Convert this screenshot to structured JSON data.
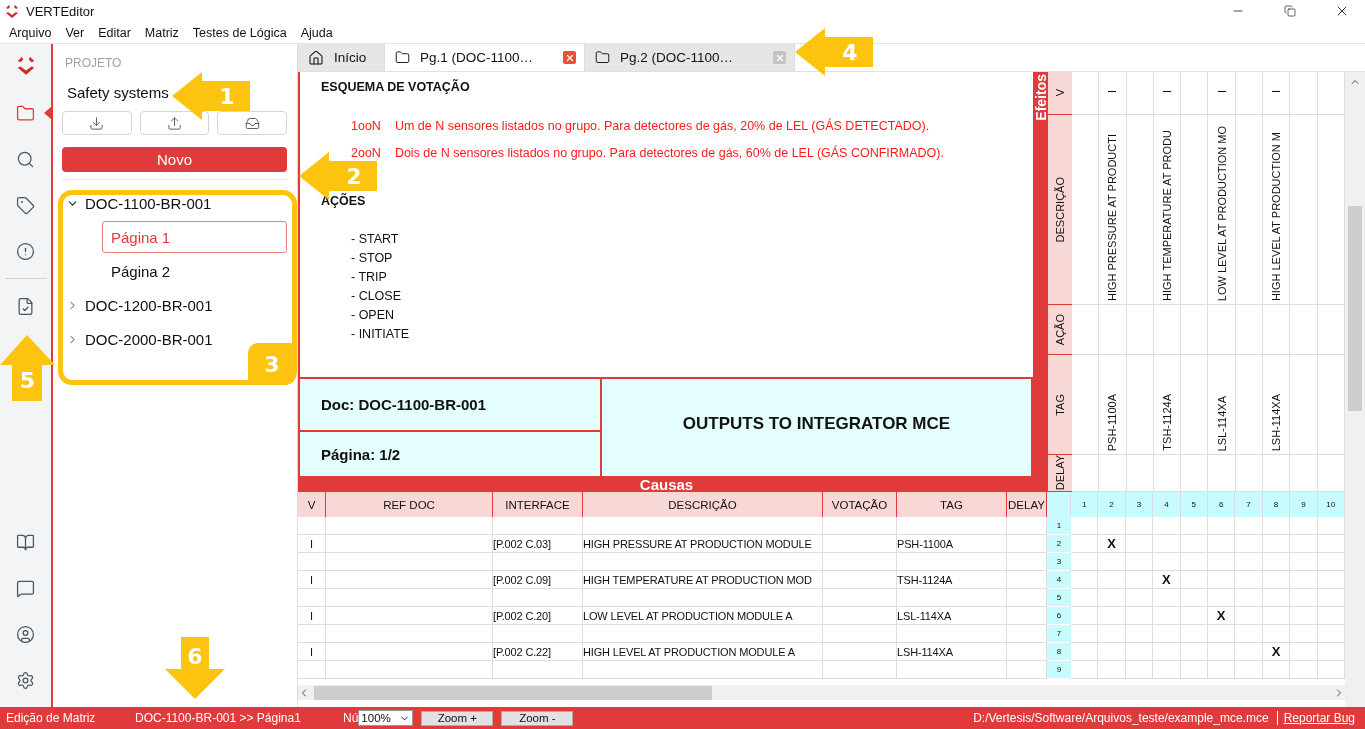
{
  "window": {
    "title": "VERTEditor"
  },
  "menu": [
    "Arquivo",
    "Ver",
    "Editar",
    "Matriz",
    "Testes de Lógica",
    "Ajuda"
  ],
  "rail": [
    {
      "selected": true
    },
    {
      "selected": false
    },
    {
      "selected": false
    },
    {
      "selected": false
    },
    {
      "selected": false
    },
    {
      "selected": false
    },
    {
      "selected": false
    },
    {
      "selected": false
    },
    {
      "selected": false
    }
  ],
  "project": {
    "label": "PROJETO",
    "name": "Safety systems",
    "new_button": "Novo",
    "tree": [
      {
        "label": "DOC-1100-BR-001",
        "expanded": true,
        "children": [
          {
            "label": "Página 1",
            "selected": true
          },
          {
            "label": "Página 2",
            "selected": false
          }
        ]
      },
      {
        "label": "DOC-1200-BR-001",
        "expanded": false
      },
      {
        "label": "DOC-2000-BR-001",
        "expanded": false
      }
    ]
  },
  "tabs": [
    {
      "kind": "home",
      "label": "Início",
      "selected": false
    },
    {
      "kind": "page",
      "label": "Pg.1 (DOC-1100…",
      "selected": true
    },
    {
      "kind": "page",
      "label": "Pg.2 (DOC-1100…",
      "selected": false
    }
  ],
  "document": {
    "voting_title": "ESQUEMA DE VOTAÇÃO",
    "voting": [
      {
        "code": "1ooN",
        "text": "Um de N sensores listados no grupo. Para detectores de gás, 20% de LEL (GÁS DETECTADO)."
      },
      {
        "code": "2ooN",
        "text": "Dois de N sensores listados no grupo. Para detectores de gás, 60% de LEL (GÁS CONFIRMADO)."
      }
    ],
    "actions_title": "AÇÕES",
    "actions": [
      "- START",
      "- STOP",
      "- TRIP",
      "- CLOSE",
      "- OPEN",
      "- INITIATE"
    ],
    "doc": "Doc: DOC-1100-BR-001",
    "page": "Página: 1/2",
    "title": "OUTPUTS TO INTEGRATOR MCE"
  },
  "causes": {
    "title": "Causas",
    "columns": [
      "V",
      "REF DOC",
      "INTERFACE",
      "DESCRIÇÃO",
      "VOTAÇÃO",
      "TAG",
      "DELAY"
    ],
    "matrix_columns": [
      "1",
      "2",
      "3",
      "4",
      "5",
      "6",
      "7",
      "8",
      "9",
      "10"
    ],
    "rows": [
      {
        "number": "1"
      },
      {
        "number": "2",
        "v": "I",
        "interface": "[P.002 C.03]",
        "description": "HIGH PRESSURE AT PRODUCTION MODULE",
        "tag": "PSH-1100A",
        "mark": "X",
        "marks": [
          {
            "checked": false
          },
          {
            "checked": true
          },
          {
            "checked": false
          },
          {
            "checked": false
          },
          {
            "checked": false
          },
          {
            "checked": false
          },
          {
            "checked": false
          },
          {
            "checked": false
          },
          {
            "checked": false
          },
          {
            "checked": false
          }
        ]
      },
      {
        "number": "3"
      },
      {
        "number": "4",
        "v": "I",
        "interface": "[P.002 C.09]",
        "description": "HIGH TEMPERATURE AT PRODUCTION MOD",
        "tag": "TSH-1124A",
        "mark": "X",
        "marks": [
          {
            "checked": false
          },
          {
            "checked": false
          },
          {
            "checked": false
          },
          {
            "checked": true
          },
          {
            "checked": false
          },
          {
            "checked": false
          },
          {
            "checked": false
          },
          {
            "checked": false
          },
          {
            "checked": false
          },
          {
            "checked": false
          }
        ]
      },
      {
        "number": "5"
      },
      {
        "number": "6",
        "v": "I",
        "interface": "[P.002 C.20]",
        "description": "LOW LEVEL AT PRODUCTION MODULE A",
        "tag": "LSL-114XA",
        "mark": "X",
        "marks": [
          {
            "checked": false
          },
          {
            "checked": false
          },
          {
            "checked": false
          },
          {
            "checked": false
          },
          {
            "checked": false
          },
          {
            "checked": true
          },
          {
            "checked": false
          },
          {
            "checked": false
          },
          {
            "checked": false
          },
          {
            "checked": false
          }
        ]
      },
      {
        "number": "7"
      },
      {
        "number": "8",
        "v": "I",
        "interface": "[P.002 C.22]",
        "description": "HIGH LEVEL AT PRODUCTION MODULE A",
        "tag": "LSH-114XA",
        "mark": "X",
        "marks": [
          {
            "checked": false
          },
          {
            "checked": false
          },
          {
            "checked": false
          },
          {
            "checked": false
          },
          {
            "checked": false
          },
          {
            "checked": false
          },
          {
            "checked": false
          },
          {
            "checked": true
          },
          {
            "checked": false
          },
          {
            "checked": false
          }
        ]
      },
      {
        "number": "9"
      }
    ]
  },
  "effects": {
    "title": "Efeitos",
    "row_labels": [
      "V",
      "DESCRIÇÃO",
      "AÇÃO",
      "TAG",
      "DELAY"
    ],
    "columns": [
      {},
      {
        "v": "I",
        "description": "HIGH PRESSURE AT PRODUCTI",
        "tag": "PSH-1100A"
      },
      {},
      {
        "v": "I",
        "description": "HIGH TEMPERATURE AT PRODU",
        "tag": "TSH-1124A"
      },
      {},
      {
        "v": "I",
        "description": "LOW LEVEL AT PRODUCTION MO",
        "tag": "LSL-114XA"
      },
      {},
      {
        "v": "I",
        "description": "HIGH LEVEL AT PRODUCTION M",
        "tag": "LSH-114XA"
      },
      {},
      {}
    ]
  },
  "status_bar": {
    "mode": "Edição de Matriz",
    "breadcrumb": "DOC-1100-BR-001 >> Página1",
    "label": "Nú",
    "zoom": "100%",
    "zoom_in": "Zoom +",
    "zoom_out": "Zoom -",
    "path": "D:/Vertesis/Software/Arquivos_teste/example_mce.mce",
    "report_link": "Reportar Bug"
  },
  "annotations": [
    {
      "kind": "arrow-left",
      "label": "1"
    },
    {
      "kind": "arrow-left",
      "label": "2"
    },
    {
      "kind": "frame",
      "label": "3"
    },
    {
      "kind": "arrow-left",
      "label": "4"
    },
    {
      "kind": "arrow-up",
      "label": "5"
    },
    {
      "kind": "arrow-down",
      "label": "6"
    }
  ]
}
